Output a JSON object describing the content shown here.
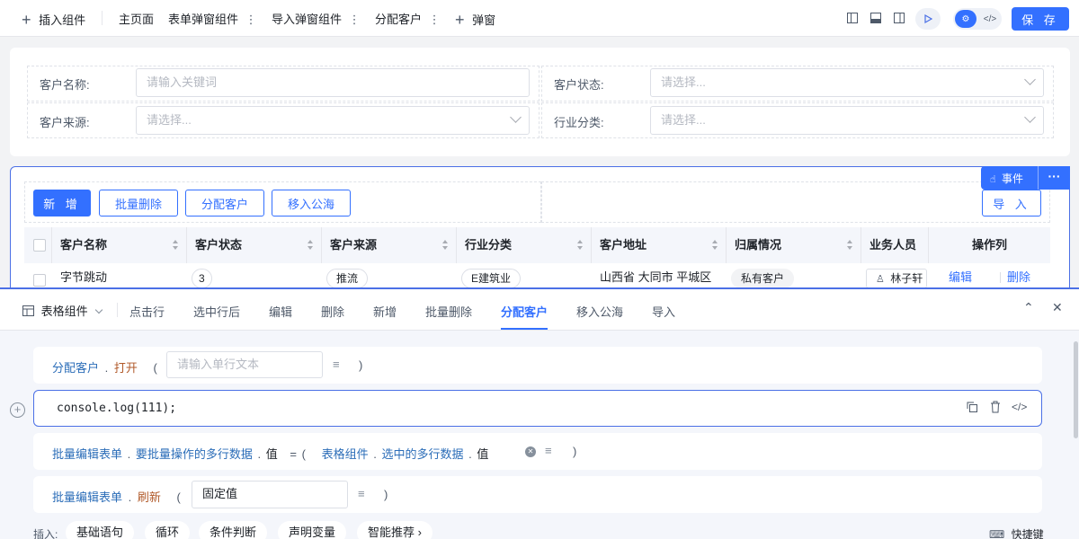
{
  "toolbar": {
    "insert_label": "插入组件",
    "tabs": [
      {
        "label": "主页面"
      },
      {
        "label": "表单弹窗组件"
      },
      {
        "label": "导入弹窗组件"
      },
      {
        "label": "分配客户"
      }
    ],
    "popup_label": "弹窗",
    "save_label": "保 存"
  },
  "filters": {
    "customer_name": {
      "label": "客户名称:",
      "placeholder": "请输入关键词"
    },
    "customer_status": {
      "label": "客户状态:",
      "placeholder": "请选择..."
    },
    "customer_source": {
      "label": "客户来源:",
      "placeholder": "请选择..."
    },
    "industry": {
      "label": "行业分类:",
      "placeholder": "请选择..."
    }
  },
  "table_actions": {
    "add": "新 增",
    "batch_delete": "批量删除",
    "assign": "分配客户",
    "move_public": "移入公海",
    "import": "导 入"
  },
  "event_bar": {
    "label": "事件",
    "more": "···"
  },
  "table": {
    "columns": [
      "客户名称",
      "客户状态",
      "客户来源",
      "行业分类",
      "客户地址",
      "归属情况",
      "业务人员",
      "操作列"
    ],
    "rows": [
      {
        "name": "字节跳动",
        "status": "3",
        "source": "推流",
        "industry": "E建筑业",
        "address": "山西省 大同市 平城区",
        "ownership": "私有客户",
        "salesperson": "林子轩",
        "edit": "编辑",
        "delete": "删除"
      }
    ]
  },
  "bottom_panel": {
    "component_label": "表格组件",
    "tabs": [
      "点击行",
      "选中行后",
      "编辑",
      "删除",
      "新增",
      "批量删除",
      "分配客户",
      "移入公海",
      "导入"
    ],
    "active_tab": "分配客户",
    "rows": {
      "open": {
        "target": "分配客户",
        "dot": ".",
        "method": "打开",
        "paren_open": "(",
        "placeholder": "请输入单行文本",
        "paren_close": ")"
      },
      "code": {
        "text": "console.log(111);"
      },
      "assign": {
        "target": "批量编辑表单",
        "dot1": ".",
        "field": "要批量操作的多行数据",
        "dot2": ".",
        "prop": "值",
        "eq": "=",
        "paren_open": "(",
        "src": "表格组件",
        "dot3": ".",
        "src_field": "选中的多行数据",
        "dot4": ".",
        "src_prop": "值",
        "paren_close": ")"
      },
      "refresh": {
        "target": "批量编辑表单",
        "dot": ".",
        "method": "刷新",
        "paren_open": "(",
        "value": "固定值",
        "paren_close": ")"
      }
    },
    "insert_label": "插入:",
    "insert_pills": [
      "基础语句",
      "循环",
      "条件判断",
      "声明变量",
      "智能推荐 ›"
    ],
    "shortcut_label": "快捷键"
  },
  "colors": {
    "primary": "#3370ff",
    "border_accent": "#4b70e6"
  }
}
